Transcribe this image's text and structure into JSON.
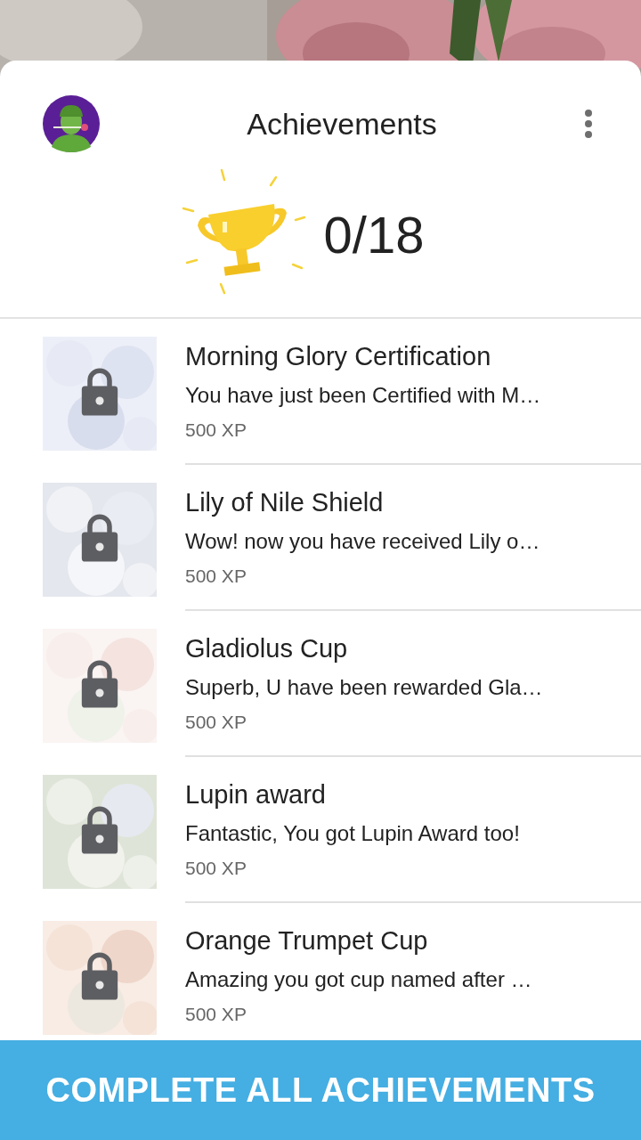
{
  "header": {
    "title": "Achievements",
    "progress": "0/18"
  },
  "achievements": [
    {
      "title": "Morning Glory Certification",
      "description": "You have just been Certified with M…",
      "xp": "500 XP",
      "locked": true
    },
    {
      "title": "Lily of Nile Shield",
      "description": "Wow!  now you have received Lily o…",
      "xp": "500 XP",
      "locked": true
    },
    {
      "title": "Gladiolus Cup",
      "description": "Superb, U have been rewarded Gla…",
      "xp": "500 XP",
      "locked": true
    },
    {
      "title": "Lupin award",
      "description": "Fantastic, You got Lupin Award too!",
      "xp": "500 XP",
      "locked": true
    },
    {
      "title": "Orange Trumpet Cup",
      "description": "Amazing you got cup named after …",
      "xp": "500 XP",
      "locked": true
    }
  ],
  "banner": {
    "text": "COMPLETE ALL ACHIEVEMENTS"
  }
}
